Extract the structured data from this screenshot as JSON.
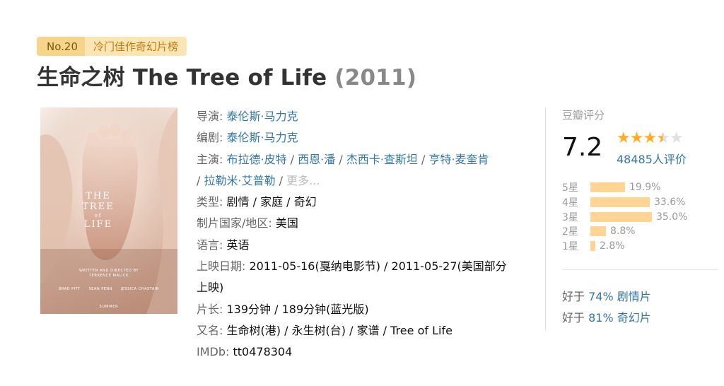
{
  "badge": {
    "rank": "No.20",
    "list_name": "冷门佳作奇幻片榜"
  },
  "title": {
    "name": "生命之树 The Tree of Life",
    "year": "(2011)"
  },
  "poster": {
    "title_line1": "THE",
    "title_line2": "TREE",
    "title_line3": "of",
    "title_line4": "LIFE",
    "credit_line1": "WRITTEN AND DIRECTED BY",
    "credit_line2": "TERRENCE MALICK",
    "cast": [
      "BRAD PITT",
      "SEAN PENN",
      "JESSICA CHASTAIN"
    ],
    "season": "SUMMER"
  },
  "info": {
    "director_label": "导演:",
    "director": "泰伦斯·马力克",
    "writer_label": "编剧:",
    "writer": "泰伦斯·马力克",
    "cast_label": "主演:",
    "cast": [
      "布拉德·皮特",
      "西恩·潘",
      "杰西卡·查斯坦",
      "亨特·麦奎肯",
      "拉勒米·艾普勒"
    ],
    "cast_sep": " / ",
    "more": "更多...",
    "genre_label": "类型:",
    "genre": "剧情 / 家庭 / 奇幻",
    "country_label": "制片国家/地区:",
    "country": "美国",
    "language_label": "语言:",
    "language": "英语",
    "release_label": "上映日期:",
    "release_part1": "2011-05-16(戛纳电影节) / 2011-05-27(美国部分",
    "release_part2": "上映)",
    "runtime_label": "片长:",
    "runtime": "139分钟 / 189分钟(蓝光版)",
    "aka_label": "又名:",
    "aka": "生命树(港) / 永生树(台) / 家谱 / Tree of Life",
    "imdb_label": "IMDb:",
    "imdb": "tt0478304"
  },
  "rating": {
    "label": "豆瓣评分",
    "score": "7.2",
    "stars_value": 3.5,
    "votes": "48485人评价",
    "distribution": [
      {
        "label": "5星",
        "pct": "19.9%",
        "value": 19.9
      },
      {
        "label": "4星",
        "pct": "33.6%",
        "value": 33.6
      },
      {
        "label": "3星",
        "pct": "35.0%",
        "value": 35.0
      },
      {
        "label": "2星",
        "pct": "8.8%",
        "value": 8.8
      },
      {
        "label": "1星",
        "pct": "2.8%",
        "value": 2.8
      }
    ],
    "better_than": [
      {
        "prefix": "好于 ",
        "link": "74% 剧情片"
      },
      {
        "prefix": "好于 ",
        "link": "81% 奇幻片"
      }
    ]
  },
  "colors": {
    "link": "#3377aa",
    "star": "#ffac2d",
    "bar": "#ffd596",
    "badge_dark": "#f6d48a",
    "badge_light": "#fbe5b3"
  }
}
